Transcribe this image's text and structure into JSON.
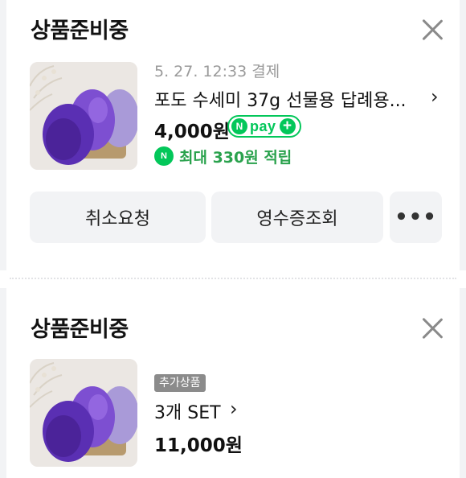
{
  "order1": {
    "status": "상품준비중",
    "close_icon": "close-icon",
    "payment_datetime": "5. 27. 12:33 결제",
    "product_name": "포도 수세미 37g 선물용 답례용...",
    "chevron": "›",
    "price": "4,000원",
    "npay_badge": {
      "n": "N",
      "label": "pay",
      "plus": "+"
    },
    "reward": {
      "icon": "N",
      "text": "최대 330원 적립"
    },
    "buttons": {
      "cancel": "취소요청",
      "receipt": "영수증조회",
      "more": "•••"
    }
  },
  "order2": {
    "status": "상품준비중",
    "close_icon": "close-icon",
    "tag": "추가상품",
    "option_name": "3개 SET",
    "chevron": "›",
    "price": "11,000원"
  },
  "colors": {
    "accent_green": "#03c75a",
    "reward_green": "#2aa24d",
    "button_bg": "#f2f3f5",
    "muted_text": "#9a9a9a",
    "tag_bg": "#8b8b8b"
  }
}
